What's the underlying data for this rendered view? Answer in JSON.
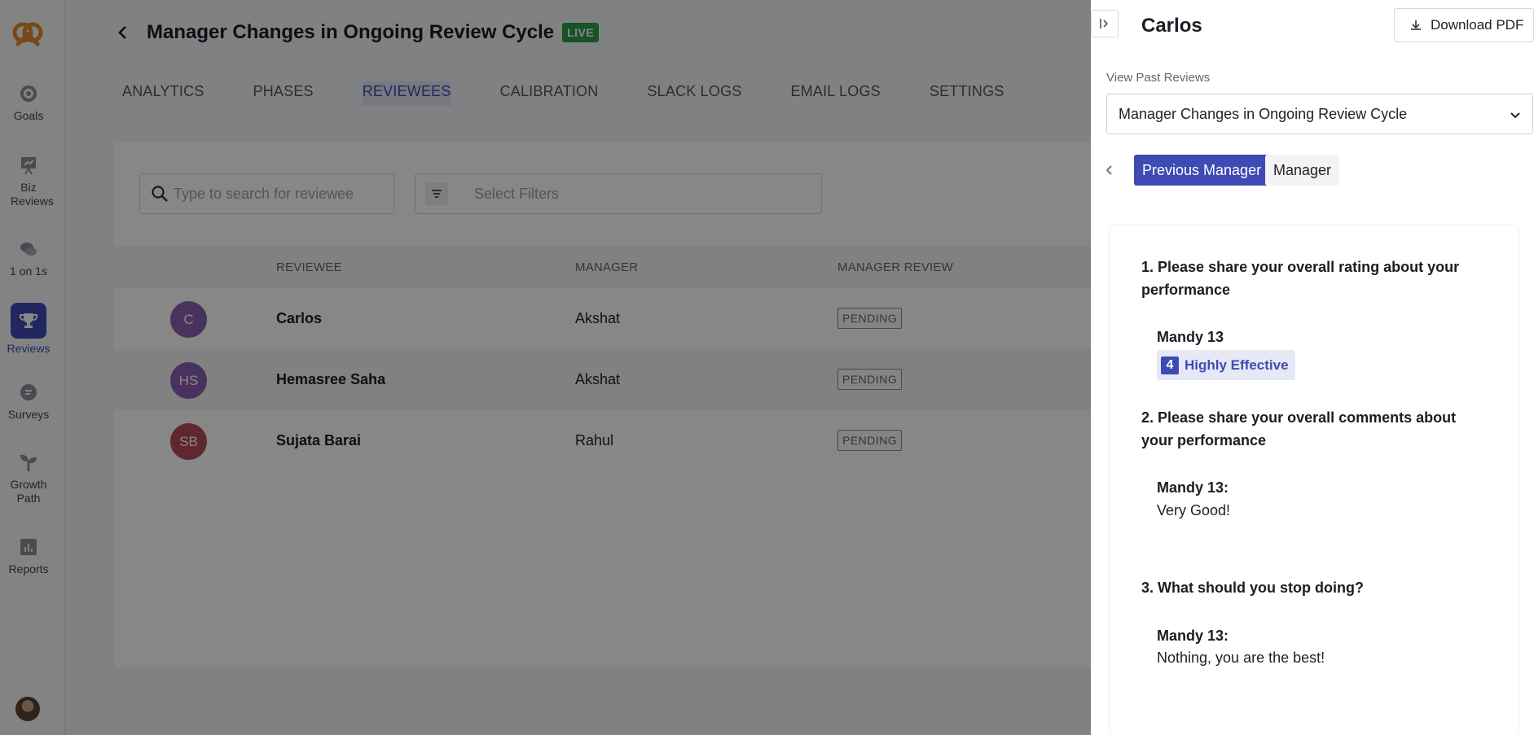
{
  "sidebar": {
    "items": [
      {
        "label": "Goals",
        "icon": "target-icon"
      },
      {
        "label": "Biz Reviews",
        "icon": "presentation-icon"
      },
      {
        "label": "1 on 1s",
        "icon": "chat-icon"
      },
      {
        "label": "Reviews",
        "icon": "trophy-icon"
      },
      {
        "label": "Surveys",
        "icon": "survey-icon"
      },
      {
        "label": "Growth Path",
        "icon": "sprout-icon"
      },
      {
        "label": "Reports",
        "icon": "bar-chart-icon"
      }
    ]
  },
  "header": {
    "title": "Manager Changes in Ongoing Review Cycle",
    "badge": "LIVE"
  },
  "tabs": [
    "ANALYTICS",
    "PHASES",
    "REVIEWEES",
    "CALIBRATION",
    "SLACK LOGS",
    "EMAIL LOGS",
    "SETTINGS"
  ],
  "search": {
    "placeholder": "Type to search for reviewee"
  },
  "filters": {
    "placeholder": "Select Filters"
  },
  "table": {
    "columns": [
      "REVIEWEE",
      "MANAGER",
      "MANAGER REVIEW"
    ],
    "rows": [
      {
        "initials": "C",
        "name": "Carlos",
        "manager": "Akshat",
        "status": "PENDING",
        "avatar_color": "#8b5fb0"
      },
      {
        "initials": "HS",
        "name": "Hemasree Saha",
        "manager": "Akshat",
        "status": "PENDING",
        "avatar_color": "#8b5fb0"
      },
      {
        "initials": "SB",
        "name": "Sujata Barai",
        "manager": "Rahul",
        "status": "PENDING",
        "avatar_color": "#b34a5a"
      }
    ]
  },
  "drawer": {
    "title": "Carlos",
    "download_label": "Download PDF",
    "past_reviews_label": "View Past Reviews",
    "selected_cycle": "Manager Changes in Ongoing Review Cycle",
    "chips": [
      "Previous Manager",
      "Manager"
    ],
    "questions": [
      {
        "question": "1. Please share your overall rating about your performance",
        "responder": "Mandy 13",
        "rating_value": "4",
        "rating_label": "Highly Effective"
      },
      {
        "question": "2. Please share your overall comments about your performance",
        "responder": "Mandy 13:",
        "answer": "Very Good!"
      },
      {
        "question": "3. What should you stop doing?",
        "responder": "Mandy 13:",
        "answer": "Nothing, you are the best!"
      }
    ]
  },
  "colors": {
    "accent": "#3f4bb4",
    "live": "#2e9c4a"
  }
}
